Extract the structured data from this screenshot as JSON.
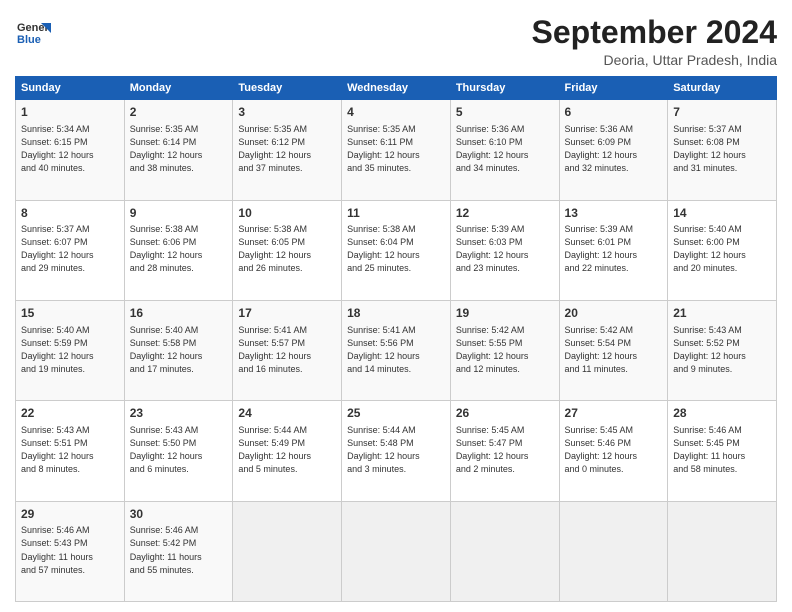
{
  "header": {
    "logo_general": "General",
    "logo_blue": "Blue",
    "month_title": "September 2024",
    "subtitle": "Deoria, Uttar Pradesh, India"
  },
  "weekdays": [
    "Sunday",
    "Monday",
    "Tuesday",
    "Wednesday",
    "Thursday",
    "Friday",
    "Saturday"
  ],
  "weeks": [
    [
      {
        "day": "1",
        "info": "Sunrise: 5:34 AM\nSunset: 6:15 PM\nDaylight: 12 hours\nand 40 minutes."
      },
      {
        "day": "2",
        "info": "Sunrise: 5:35 AM\nSunset: 6:14 PM\nDaylight: 12 hours\nand 38 minutes."
      },
      {
        "day": "3",
        "info": "Sunrise: 5:35 AM\nSunset: 6:12 PM\nDaylight: 12 hours\nand 37 minutes."
      },
      {
        "day": "4",
        "info": "Sunrise: 5:35 AM\nSunset: 6:11 PM\nDaylight: 12 hours\nand 35 minutes."
      },
      {
        "day": "5",
        "info": "Sunrise: 5:36 AM\nSunset: 6:10 PM\nDaylight: 12 hours\nand 34 minutes."
      },
      {
        "day": "6",
        "info": "Sunrise: 5:36 AM\nSunset: 6:09 PM\nDaylight: 12 hours\nand 32 minutes."
      },
      {
        "day": "7",
        "info": "Sunrise: 5:37 AM\nSunset: 6:08 PM\nDaylight: 12 hours\nand 31 minutes."
      }
    ],
    [
      {
        "day": "8",
        "info": "Sunrise: 5:37 AM\nSunset: 6:07 PM\nDaylight: 12 hours\nand 29 minutes."
      },
      {
        "day": "9",
        "info": "Sunrise: 5:38 AM\nSunset: 6:06 PM\nDaylight: 12 hours\nand 28 minutes."
      },
      {
        "day": "10",
        "info": "Sunrise: 5:38 AM\nSunset: 6:05 PM\nDaylight: 12 hours\nand 26 minutes."
      },
      {
        "day": "11",
        "info": "Sunrise: 5:38 AM\nSunset: 6:04 PM\nDaylight: 12 hours\nand 25 minutes."
      },
      {
        "day": "12",
        "info": "Sunrise: 5:39 AM\nSunset: 6:03 PM\nDaylight: 12 hours\nand 23 minutes."
      },
      {
        "day": "13",
        "info": "Sunrise: 5:39 AM\nSunset: 6:01 PM\nDaylight: 12 hours\nand 22 minutes."
      },
      {
        "day": "14",
        "info": "Sunrise: 5:40 AM\nSunset: 6:00 PM\nDaylight: 12 hours\nand 20 minutes."
      }
    ],
    [
      {
        "day": "15",
        "info": "Sunrise: 5:40 AM\nSunset: 5:59 PM\nDaylight: 12 hours\nand 19 minutes."
      },
      {
        "day": "16",
        "info": "Sunrise: 5:40 AM\nSunset: 5:58 PM\nDaylight: 12 hours\nand 17 minutes."
      },
      {
        "day": "17",
        "info": "Sunrise: 5:41 AM\nSunset: 5:57 PM\nDaylight: 12 hours\nand 16 minutes."
      },
      {
        "day": "18",
        "info": "Sunrise: 5:41 AM\nSunset: 5:56 PM\nDaylight: 12 hours\nand 14 minutes."
      },
      {
        "day": "19",
        "info": "Sunrise: 5:42 AM\nSunset: 5:55 PM\nDaylight: 12 hours\nand 12 minutes."
      },
      {
        "day": "20",
        "info": "Sunrise: 5:42 AM\nSunset: 5:54 PM\nDaylight: 12 hours\nand 11 minutes."
      },
      {
        "day": "21",
        "info": "Sunrise: 5:43 AM\nSunset: 5:52 PM\nDaylight: 12 hours\nand 9 minutes."
      }
    ],
    [
      {
        "day": "22",
        "info": "Sunrise: 5:43 AM\nSunset: 5:51 PM\nDaylight: 12 hours\nand 8 minutes."
      },
      {
        "day": "23",
        "info": "Sunrise: 5:43 AM\nSunset: 5:50 PM\nDaylight: 12 hours\nand 6 minutes."
      },
      {
        "day": "24",
        "info": "Sunrise: 5:44 AM\nSunset: 5:49 PM\nDaylight: 12 hours\nand 5 minutes."
      },
      {
        "day": "25",
        "info": "Sunrise: 5:44 AM\nSunset: 5:48 PM\nDaylight: 12 hours\nand 3 minutes."
      },
      {
        "day": "26",
        "info": "Sunrise: 5:45 AM\nSunset: 5:47 PM\nDaylight: 12 hours\nand 2 minutes."
      },
      {
        "day": "27",
        "info": "Sunrise: 5:45 AM\nSunset: 5:46 PM\nDaylight: 12 hours\nand 0 minutes."
      },
      {
        "day": "28",
        "info": "Sunrise: 5:46 AM\nSunset: 5:45 PM\nDaylight: 11 hours\nand 58 minutes."
      }
    ],
    [
      {
        "day": "29",
        "info": "Sunrise: 5:46 AM\nSunset: 5:43 PM\nDaylight: 11 hours\nand 57 minutes."
      },
      {
        "day": "30",
        "info": "Sunrise: 5:46 AM\nSunset: 5:42 PM\nDaylight: 11 hours\nand 55 minutes."
      },
      {
        "day": "",
        "info": ""
      },
      {
        "day": "",
        "info": ""
      },
      {
        "day": "",
        "info": ""
      },
      {
        "day": "",
        "info": ""
      },
      {
        "day": "",
        "info": ""
      }
    ]
  ]
}
